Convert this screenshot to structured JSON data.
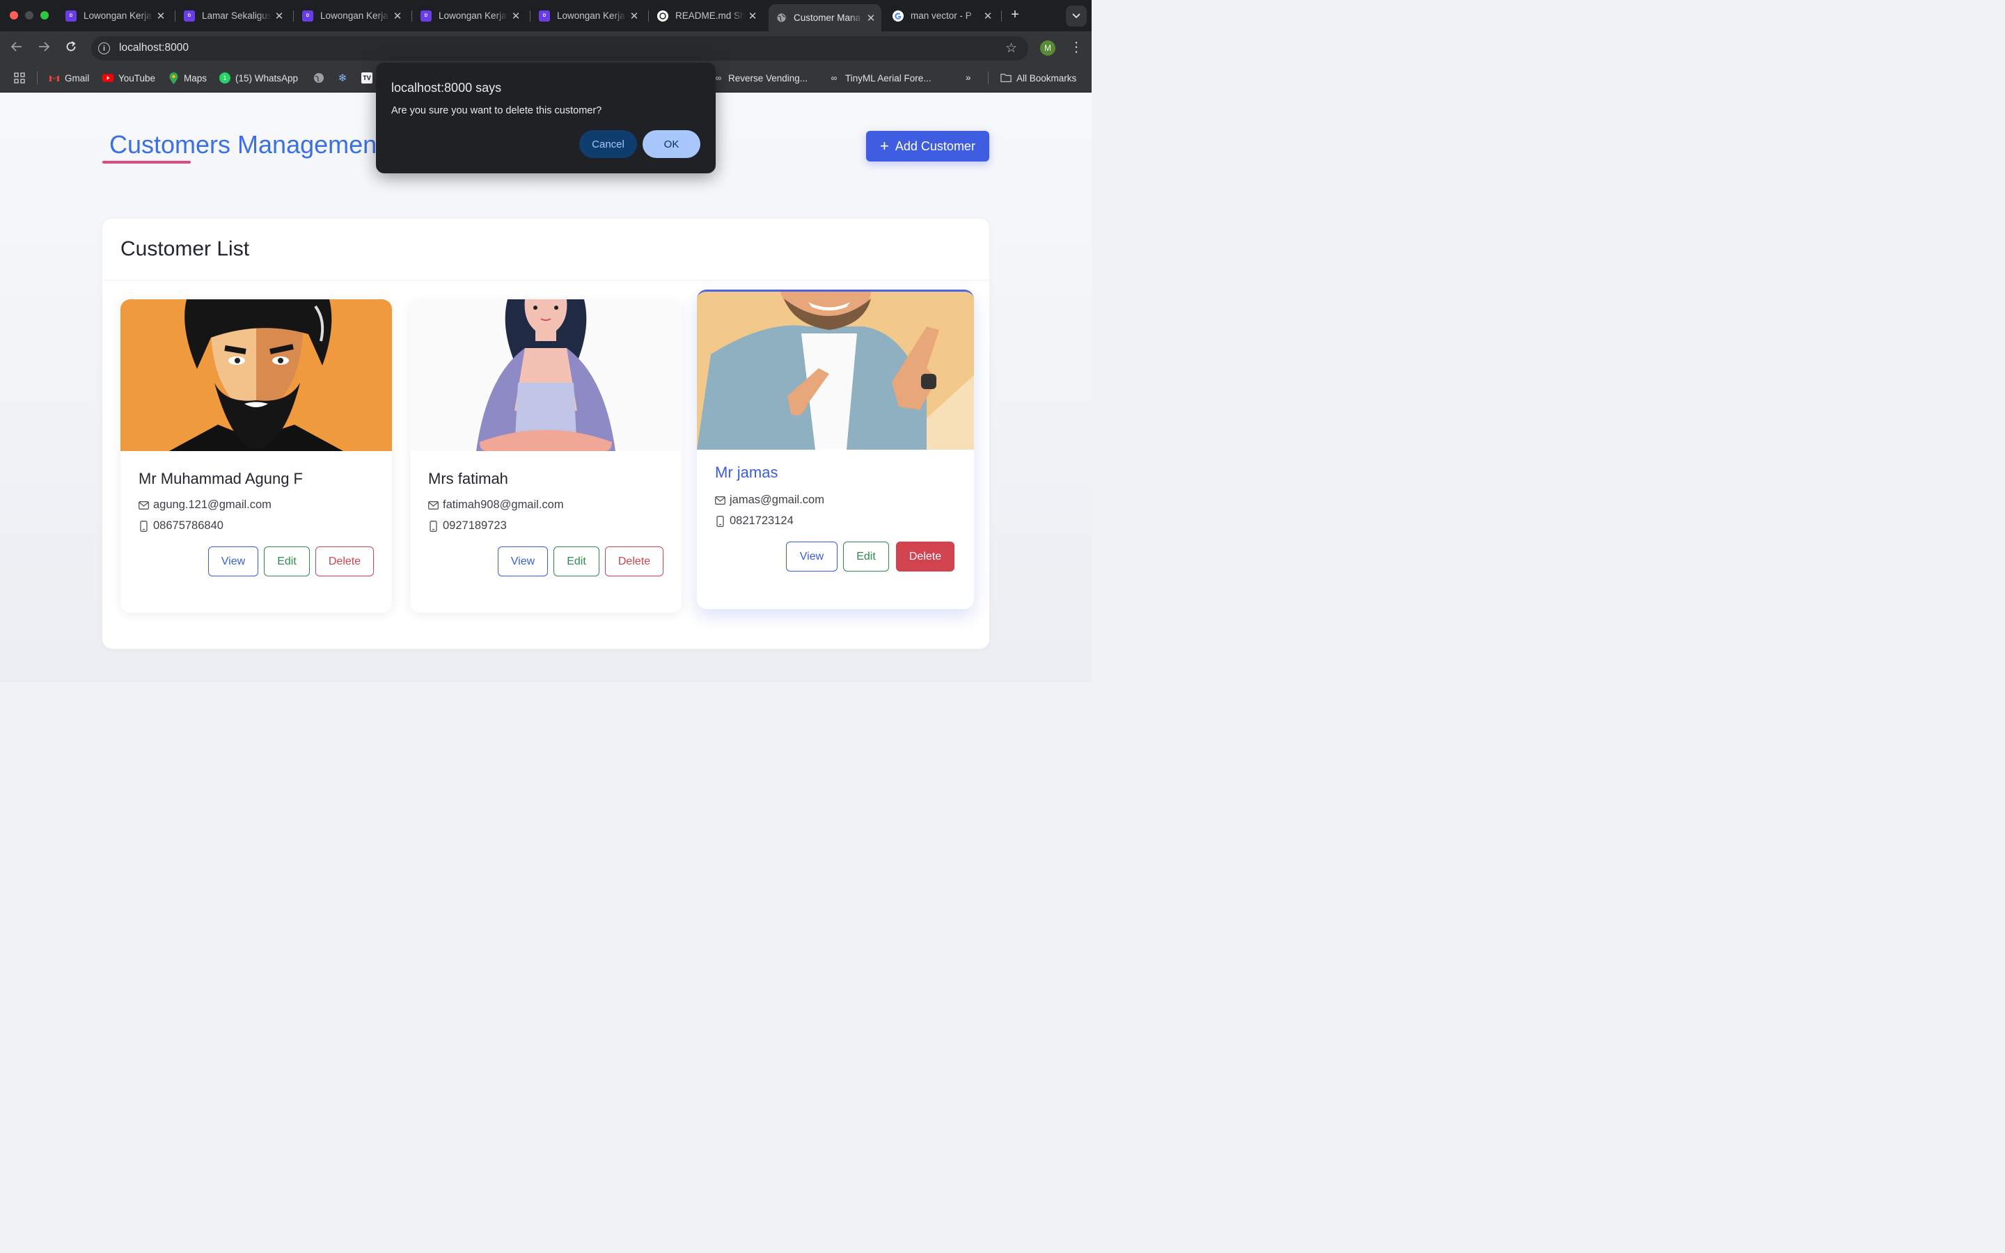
{
  "browser": {
    "tabs": [
      {
        "title": "Lowongan Kerja",
        "favicon": "dealls-icon"
      },
      {
        "title": "Lamar Sekaligus",
        "favicon": "dealls-icon"
      },
      {
        "title": "Lowongan Kerja",
        "favicon": "dealls-icon"
      },
      {
        "title": "Lowongan Kerja",
        "favicon": "dealls-icon"
      },
      {
        "title": "Lowongan Kerja",
        "favicon": "dealls-icon"
      },
      {
        "title": "README.md Sh",
        "favicon": "openai-icon"
      },
      {
        "title": "Customer Mana",
        "favicon": "globe-icon"
      },
      {
        "title": "man vector - P",
        "favicon": "google-icon"
      }
    ],
    "url": "localhost:8000",
    "profile_initial": "M",
    "bookmarks": [
      {
        "label": "Gmail"
      },
      {
        "label": "YouTube"
      },
      {
        "label": "Maps"
      },
      {
        "label": "(15) WhatsApp"
      },
      {
        "label": "Reverse Vending..."
      },
      {
        "label": "TinyML Aerial Fore..."
      },
      {
        "label": "All Bookmarks"
      }
    ]
  },
  "page": {
    "title": "Customers Management",
    "add_button": "Add Customer",
    "list_title": "Customer List",
    "customers": [
      {
        "name": "Mr Muhammad Agung F",
        "email": "agung.121@gmail.com",
        "phone": "08675786840"
      },
      {
        "name": "Mrs fatimah",
        "email": "fatimah908@gmail.com",
        "phone": "0927189723"
      },
      {
        "name": "Mr jamas",
        "email": "jamas@gmail.com",
        "phone": "0821723124"
      }
    ],
    "buttons": {
      "view": "View",
      "edit": "Edit",
      "delete": "Delete"
    }
  },
  "dialog": {
    "title": "localhost:8000 says",
    "message": "Are you sure you want to delete this customer?",
    "cancel": "Cancel",
    "ok": "OK"
  },
  "colors": {
    "accent": "#3f5de0",
    "title_blue": "#3b6fe6",
    "underline": "#e0497a",
    "view": "#3b5ed8",
    "edit": "#2e8b4e",
    "delete": "#d24350"
  }
}
